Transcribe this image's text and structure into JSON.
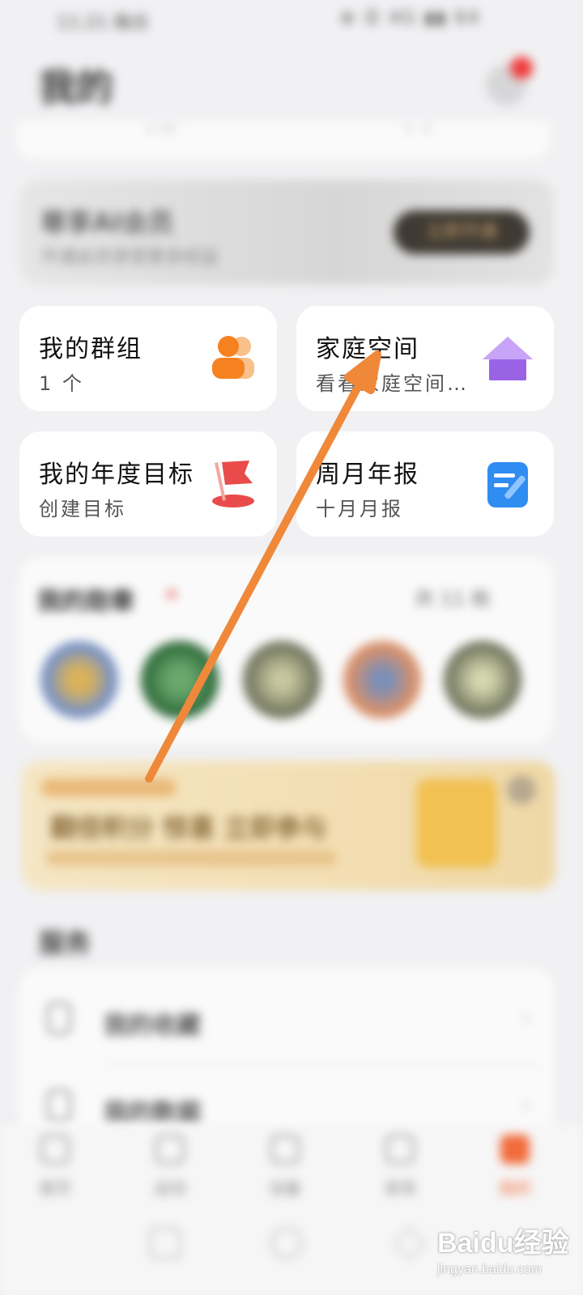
{
  "status_bar": {
    "time": "11:21 融合",
    "right": "⊕ ☰ 4G ▮▮ 64"
  },
  "header": {
    "title": "我的"
  },
  "vip_banner": {
    "title": "尊享AI会员",
    "subtitle": "开通会员享受更多权益",
    "button": "立即开通"
  },
  "cards": [
    {
      "title": "我的群组",
      "subtitle": "1 个",
      "icon": "group-icon",
      "color": "#f5821f"
    },
    {
      "title": "家庭空间",
      "subtitle": "看看家庭空间…",
      "icon": "house-icon",
      "color": "#9a63e6"
    },
    {
      "title": "我的年度目标",
      "subtitle": "创建目标",
      "icon": "flag-icon",
      "color": "#e94b4b"
    },
    {
      "title": "周月年报",
      "subtitle": "十月月报",
      "icon": "report-icon",
      "color": "#2f8cf0"
    }
  ],
  "badges": {
    "title": "我的勋章",
    "more": "共 11 枚",
    "medal_colors": [
      "#7a93c4",
      "#3f7d4a",
      "#8a8f74",
      "#d9906a",
      "#8a8f74"
    ]
  },
  "promo": {
    "title": "翻倍积分 惊喜 立即参与"
  },
  "services": {
    "section_title": "服务",
    "items": [
      {
        "label": "我的收藏"
      },
      {
        "label": "我的数据"
      }
    ]
  },
  "bottom_nav": {
    "items": [
      {
        "label": "首页",
        "active": false
      },
      {
        "label": "运动",
        "active": false
      },
      {
        "label": "设备",
        "active": false
      },
      {
        "label": "发现",
        "active": false
      },
      {
        "label": "我的",
        "active": true
      }
    ]
  },
  "watermark": {
    "text": "Baidu经验",
    "url": "jingyan.baidu.com"
  },
  "annotation": {
    "arrow_color": "#f0883a"
  }
}
